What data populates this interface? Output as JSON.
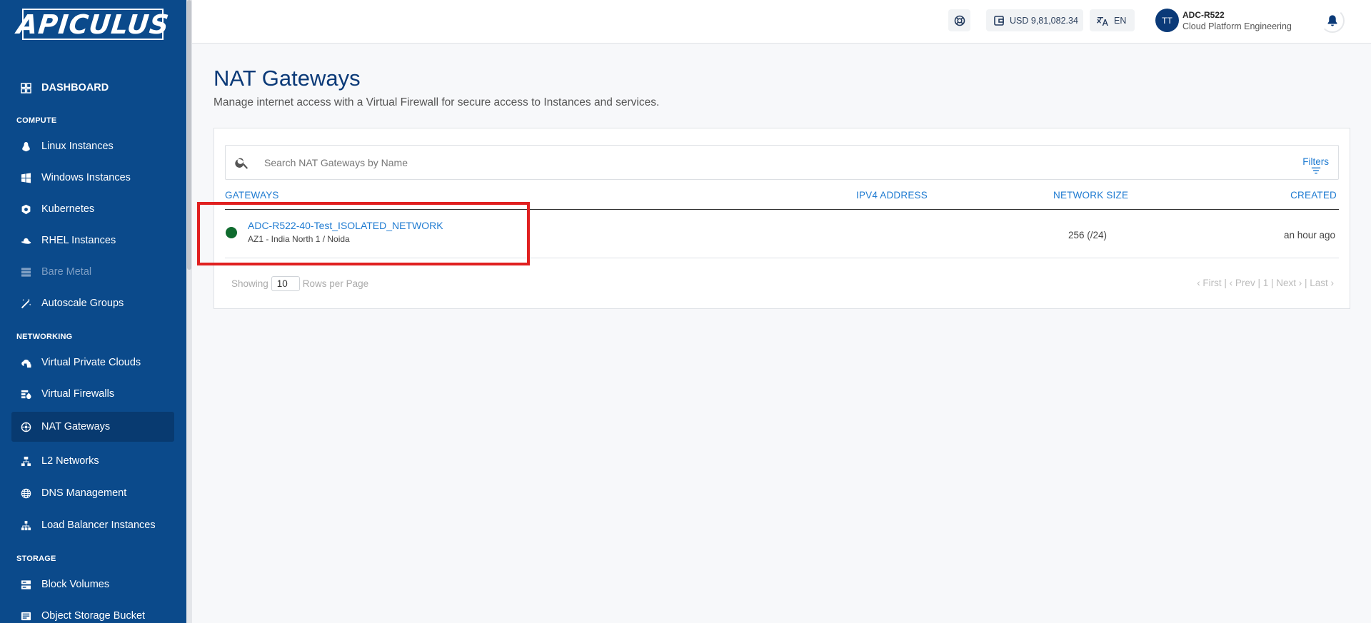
{
  "brand": {
    "logo_text": "APICULUS"
  },
  "sidebar": {
    "dashboard": "DASHBOARD",
    "sections": {
      "compute": "COMPUTE",
      "networking": "NETWORKING",
      "storage": "STORAGE"
    },
    "items": {
      "linux": "Linux Instances",
      "windows": "Windows Instances",
      "kubernetes": "Kubernetes",
      "rhel": "RHEL Instances",
      "bare_metal": "Bare Metal",
      "autoscale": "Autoscale Groups",
      "vpc": "Virtual Private Clouds",
      "firewalls": "Virtual Firewalls",
      "nat": "NAT Gateways",
      "l2": "L2 Networks",
      "dns": "DNS Management",
      "lb": "Load Balancer Instances",
      "block": "Block Volumes",
      "object": "Object Storage Bucket"
    }
  },
  "topbar": {
    "balance": "USD 9,81,082.34",
    "language": "EN",
    "avatar_initials": "TT",
    "user_name": "ADC-R522",
    "user_org": "Cloud Platform Engineering"
  },
  "page": {
    "title": "NAT Gateways",
    "subtitle": "Manage internet access with a Virtual Firewall for secure access to Instances and services."
  },
  "search": {
    "placeholder": "Search NAT Gateways by Name",
    "filters_label": "Filters"
  },
  "table": {
    "headers": {
      "gateways": "GATEWAYS",
      "ipv4": "IPV4 ADDRESS",
      "network_size": "NETWORK SIZE",
      "created": "CREATED"
    },
    "rows": [
      {
        "name": "ADC-R522-40-Test_ISOLATED_NETWORK",
        "zone": "AZ1 - India North 1 / Noida",
        "ipv4": "",
        "network_size": "256 (/24)",
        "created": "an hour ago",
        "status_color": "#0f6b2e"
      }
    ]
  },
  "pagination": {
    "showing_label": "Showing",
    "rows_value": "10",
    "rows_label": "Rows per Page",
    "pager_text": "‹ First  |  ‹ Prev   |  1 |  Next ›  |  Last ›"
  },
  "colors": {
    "sidebar_bg": "#0b4a8b",
    "accent": "#1f7bd1",
    "highlight": "#e02020"
  }
}
